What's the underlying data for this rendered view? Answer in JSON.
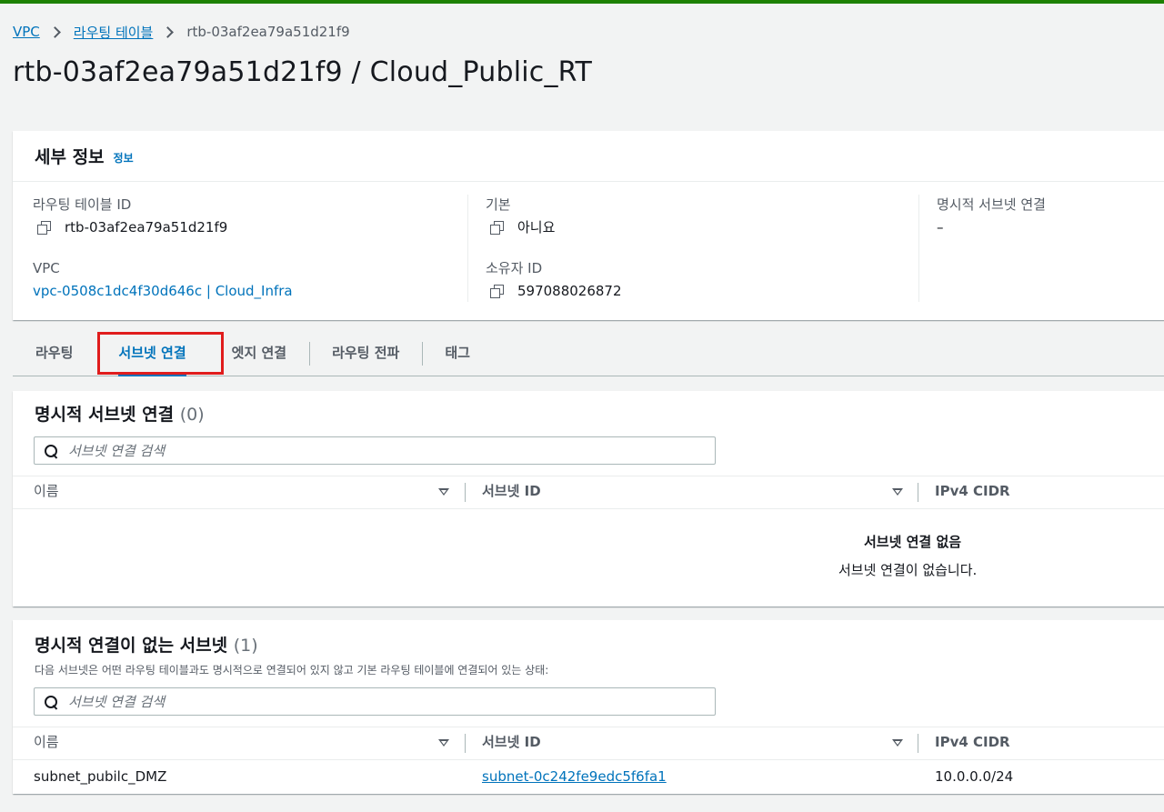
{
  "breadcrumb": {
    "vpc": "VPC",
    "route_tables": "라우팅 테이블",
    "current": "rtb-03af2ea79a51d21f9"
  },
  "page_title": "rtb-03af2ea79a51d21f9 / Cloud_Public_RT",
  "details": {
    "title": "세부 정보",
    "info_link": "정보",
    "route_table_id_label": "라우팅 테이블 ID",
    "route_table_id": "rtb-03af2ea79a51d21f9",
    "vpc_label": "VPC",
    "vpc_value": "vpc-0508c1dc4f30d646c | Cloud_Infra",
    "main_label": "기본",
    "main_value": "아니요",
    "owner_label": "소유자 ID",
    "owner_value": "597088026872",
    "explicit_label": "명시적 서브넷 연결",
    "explicit_value": "–"
  },
  "tabs": [
    {
      "label": "라우팅"
    },
    {
      "label": "서브넷 연결"
    },
    {
      "label": "엣지 연결"
    },
    {
      "label": "라우팅 전파"
    },
    {
      "label": "태그"
    }
  ],
  "explicit_assoc": {
    "title": "명시적 서브넷 연결",
    "count": "(0)",
    "search_placeholder": "서브넷 연결 검색",
    "columns": {
      "name": "이름",
      "subnet_id": "서브넷 ID",
      "cidr": "IPv4 CIDR"
    },
    "empty_title": "서브넷 연결 없음",
    "empty_text": "서브넷 연결이 없습니다."
  },
  "implicit_assoc": {
    "title": "명시적 연결이 없는 서브넷",
    "count": "(1)",
    "description": "다음 서브넷은 어떤 라우팅 테이블과도 명시적으로 연결되어 있지 않고 기본 라우팅 테이블에 연결되어 있는 상태:",
    "search_placeholder": "서브넷 연결 검색",
    "columns": {
      "name": "이름",
      "subnet_id": "서브넷 ID",
      "cidr": "IPv4 CIDR"
    },
    "rows": [
      {
        "name": "subnet_pubilc_DMZ",
        "subnet_id": "subnet-0c242fe9edc5f6fa1",
        "cidr": "10.0.0.0/24"
      }
    ]
  },
  "colors": {
    "link": "#0073bb",
    "top_bar": "#1d8102",
    "highlight": "#e01c1c"
  }
}
